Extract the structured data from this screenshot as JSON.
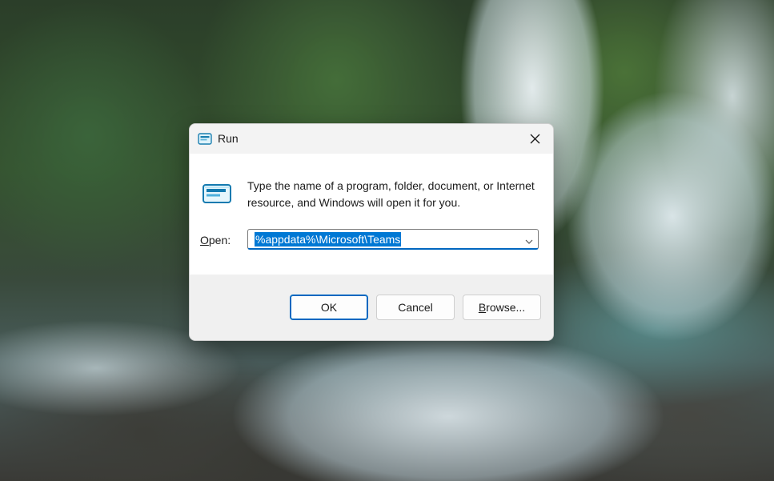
{
  "dialog": {
    "title": "Run",
    "close_icon": "close-icon",
    "app_icon": "run-icon",
    "description": "Type the name of a program, folder, document, or Internet resource, and Windows will open it for you.",
    "open_label_mnemonic": "O",
    "open_label_rest": "pen:",
    "combo_value": "%appdata%\\Microsoft\\Teams",
    "dropdown_icon": "chevron-down-icon",
    "buttons": {
      "ok": "OK",
      "cancel": "Cancel",
      "browse_mnemonic": "B",
      "browse_rest": "rowse..."
    }
  },
  "colors": {
    "accent": "#0067c0",
    "selection": "#0078d4",
    "dialog_bg": "#f0f0f0",
    "content_bg": "#ffffff"
  }
}
